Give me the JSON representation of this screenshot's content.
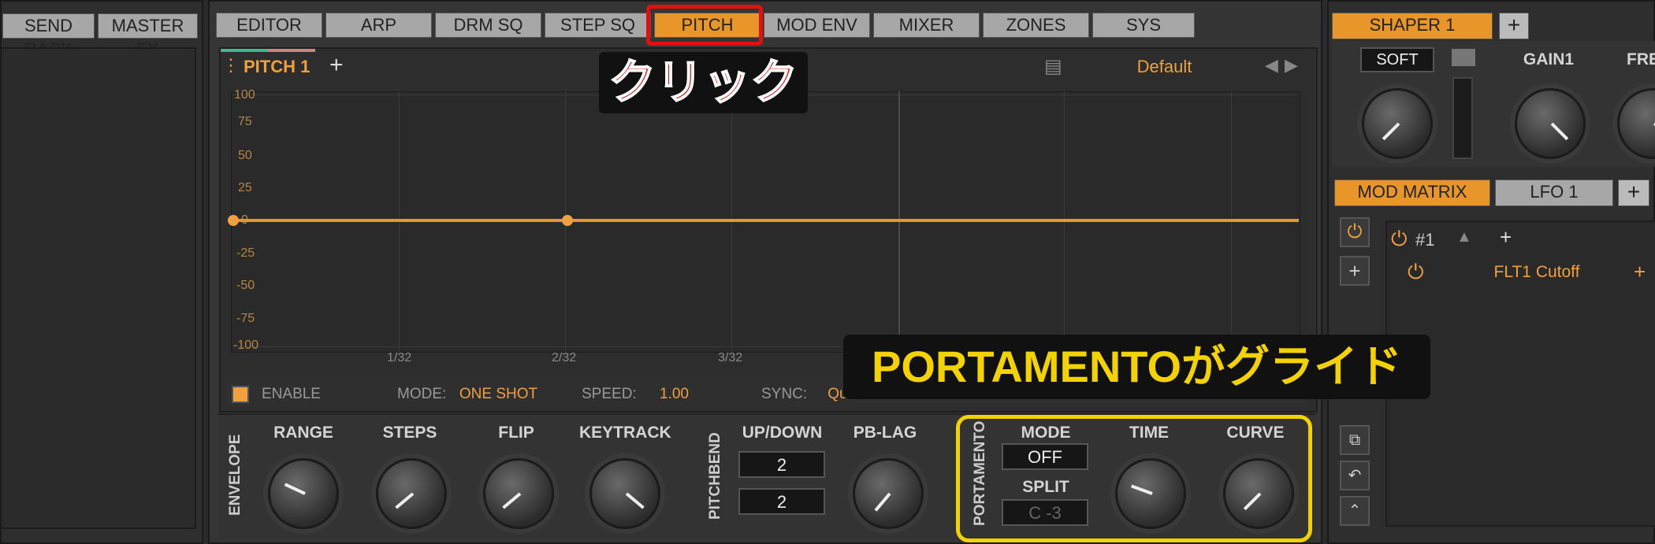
{
  "left_tabs": {
    "send_rack": "SEND RACK",
    "master_fx": "MASTER FX"
  },
  "main_tabs": [
    "EDITOR",
    "ARP",
    "DRM SQ",
    "STEP SQ",
    "PITCH",
    "MOD ENV",
    "MIXER",
    "ZONES",
    "SYS"
  ],
  "active_tab": "PITCH",
  "pitch": {
    "title": "PITCH 1",
    "add": "+",
    "preset": "Default"
  },
  "graph": {
    "y_labels": [
      "100",
      "75",
      "50",
      "25",
      "0",
      "-25",
      "-50",
      "-75",
      "-100"
    ],
    "x_labels": [
      "1/32",
      "2/32",
      "3/32"
    ]
  },
  "controls_row": {
    "enable": "ENABLE",
    "mode_label": "MODE:",
    "mode_value": "ONE SHOT",
    "speed_label": "SPEED:",
    "speed_value": "1.00",
    "sync_label": "SYNC:",
    "sync_value": "Quarter"
  },
  "envelope": {
    "section": "ENVELOPE",
    "range": "RANGE",
    "steps": "STEPS",
    "flip": "FLIP",
    "keytrack": "KEYTRACK"
  },
  "pitchbend": {
    "section": "PITCHBEND",
    "updown": "UP/DOWN",
    "up_value": "2",
    "down_value": "2",
    "pblag": "PB-LAG"
  },
  "portamento": {
    "section": "PORTAMENTO",
    "mode": "MODE",
    "mode_value": "OFF",
    "split": "SPLIT",
    "split_value": "C -3",
    "time": "TIME",
    "curve": "CURVE"
  },
  "right": {
    "shaper_tab": "SHAPER 1",
    "shaper_add": "+",
    "soft": "SOFT",
    "gain1": "GAIN1",
    "fre": "FRE",
    "mod_matrix": "MOD MATRIX",
    "lfo": "LFO 1",
    "lfo_add": "+",
    "slot": "#1",
    "slot_add": "+",
    "dest": "FLT1 Cutoff",
    "dest_add": "+"
  },
  "annotations": {
    "click": "クリック",
    "glide": "PORTAMENTOがグライド"
  },
  "colors": {
    "accent": "#e8962a",
    "annot_red": "#e01010",
    "annot_yellow": "#f2d200"
  }
}
